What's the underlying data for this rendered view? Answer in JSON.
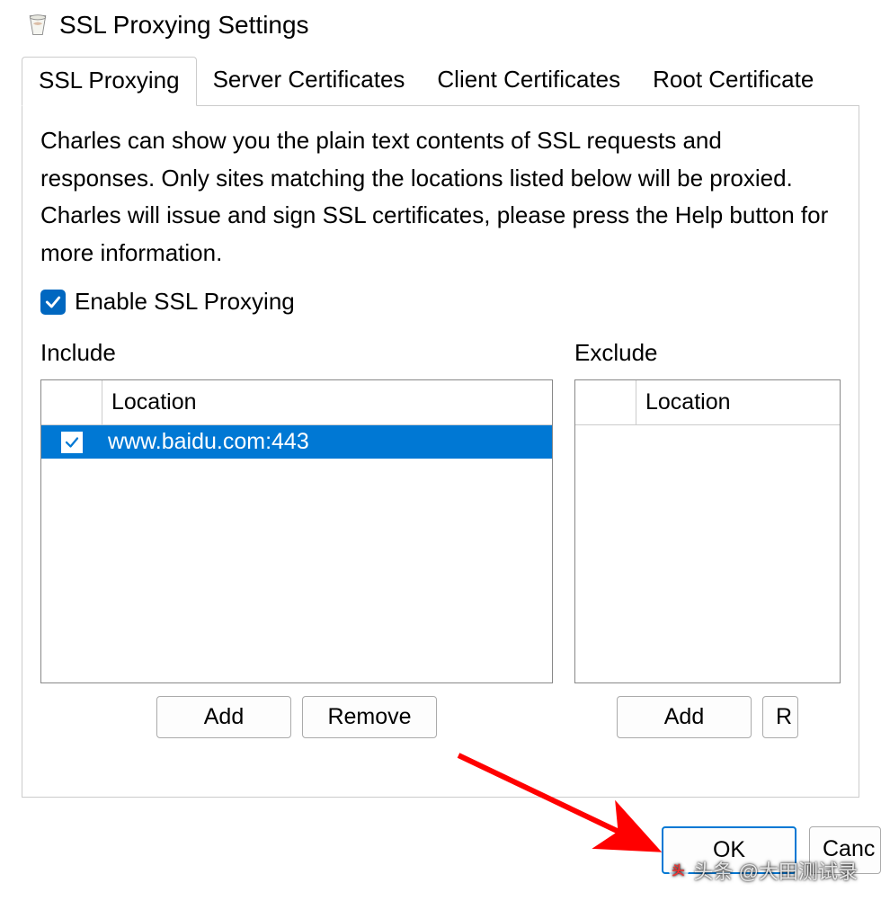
{
  "window": {
    "title": "SSL Proxying Settings"
  },
  "tabs": {
    "ssl_proxying": "SSL Proxying",
    "server_certificates": "Server Certificates",
    "client_certificates": "Client Certificates",
    "root_certificate": "Root Certificate"
  },
  "content": {
    "description": "Charles can show you the plain text contents of SSL requests and responses. Only sites matching the locations listed below will be proxied. Charles will issue and sign SSL certificates, please press the Help button for more information.",
    "enable_label": "Enable SSL Proxying",
    "enable_checked": true
  },
  "include": {
    "label": "Include",
    "header": "Location",
    "items": [
      {
        "enabled": true,
        "location": "www.baidu.com:443",
        "selected": true
      }
    ],
    "add_label": "Add",
    "remove_label": "Remove"
  },
  "exclude": {
    "label": "Exclude",
    "header": "Location",
    "items": [],
    "add_label": "Add",
    "remove_label": "R"
  },
  "dialog": {
    "ok": "OK",
    "cancel": "Canc"
  },
  "watermark": "头条 @大田测试录"
}
